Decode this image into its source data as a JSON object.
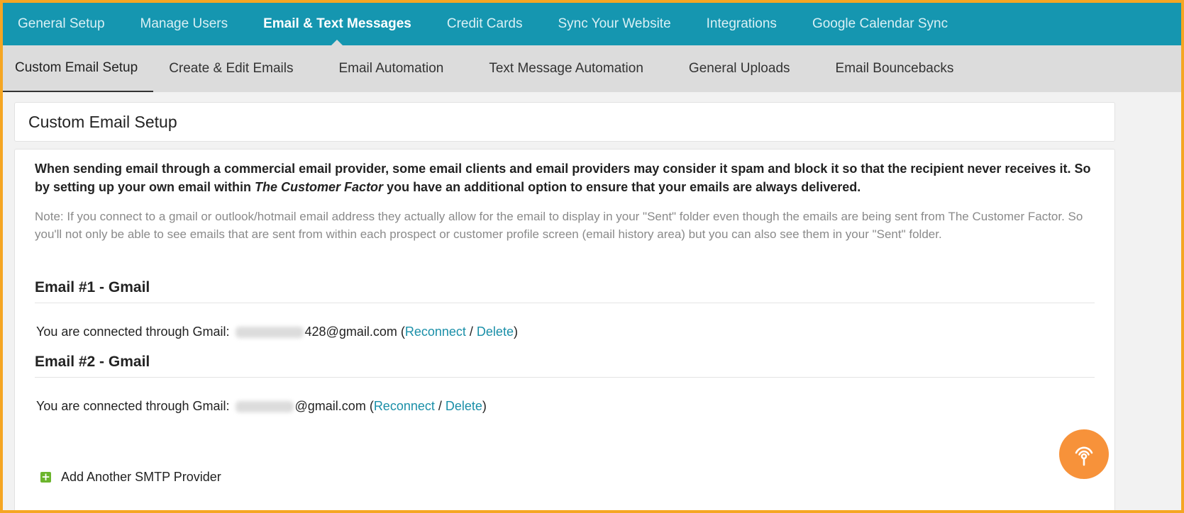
{
  "top_nav": {
    "tabs": [
      {
        "label": "General Setup",
        "active": false
      },
      {
        "label": "Manage Users",
        "active": false
      },
      {
        "label": "Email & Text Messages",
        "active": true
      },
      {
        "label": "Credit Cards",
        "active": false
      },
      {
        "label": "Sync Your Website",
        "active": false
      },
      {
        "label": "Integrations",
        "active": false
      },
      {
        "label": "Google Calendar Sync",
        "active": false
      }
    ]
  },
  "sub_nav": {
    "tabs": [
      {
        "label": "Custom Email Setup",
        "active": true
      },
      {
        "label": "Create & Edit Emails",
        "active": false
      },
      {
        "label": "Email Automation",
        "active": false
      },
      {
        "label": "Text Message Automation",
        "active": false
      },
      {
        "label": "General Uploads",
        "active": false
      },
      {
        "label": "Email Bouncebacks",
        "active": false
      }
    ]
  },
  "page_title": "Custom Email Setup",
  "intro": {
    "part1": "When sending email through a commercial email provider, some email clients and email providers may consider it spam and block it so that the recipient never receives it. So by setting up your own email within ",
    "brand": "The Customer Factor",
    "part2": " you have an additional option to ensure that your emails are always delivered."
  },
  "note": "Note: If you connect to a gmail or outlook/hotmail email address they actually allow for the email to display in your \"Sent\" folder even though the emails are being sent from The Customer Factor. So you'll not only be able to see emails that are sent from within each prospect or customer profile screen (email history area) but you can also see them in your \"Sent\" folder.",
  "emails": [
    {
      "heading": "Email #1 - Gmail",
      "connected_label": "You are connected through Gmail:",
      "address_suffix": "428@gmail.com",
      "open_paren": "(",
      "reconnect": "Reconnect",
      "slash": " / ",
      "delete": "Delete",
      "close_paren": ")"
    },
    {
      "heading": "Email #2 - Gmail",
      "connected_label": "You are connected through Gmail:",
      "address_suffix": "@gmail.com",
      "open_paren": "(",
      "reconnect": "Reconnect",
      "slash": " / ",
      "delete": "Delete",
      "close_paren": ")"
    }
  ],
  "add_provider": {
    "icon": "plus-icon",
    "label": "Add Another SMTP Provider"
  },
  "fab": {
    "icon": "broadcast-icon",
    "color": "#f7923a"
  },
  "colors": {
    "top_nav_bg": "#1596b0",
    "sub_nav_bg": "#dcdcdc",
    "link": "#1a8fa8",
    "frame_border": "#f5a623",
    "plus_green": "#6cb52d"
  }
}
